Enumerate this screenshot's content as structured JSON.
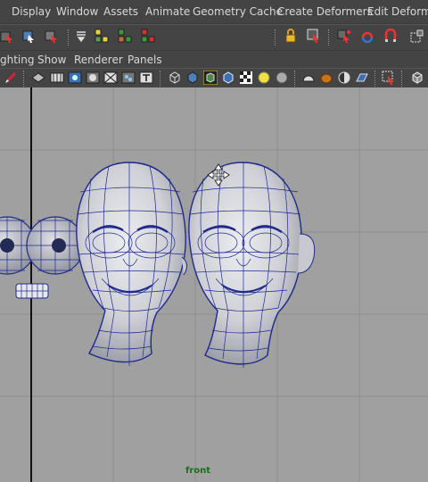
{
  "menubar": {
    "items": [
      "Display",
      "Window",
      "Assets",
      "Animate",
      "Geometry Cache",
      "Create Deformers",
      "Edit Deformers"
    ]
  },
  "panel_menu": {
    "items": [
      "ghting",
      "Show",
      "Renderer",
      "Panels"
    ]
  },
  "viewport": {
    "camera_label": "front",
    "background_color": "#a0a0a0",
    "grid_color": "#8e8e8e",
    "axis_color": "#111111",
    "wire_color": "#1f2a8a"
  },
  "icons": {
    "toolbar": [
      "select-tool-icon",
      "lasso-tool-icon",
      "paint-select-icon",
      "menu-collapse-icon",
      "snap-grid-icon",
      "snap-curve-icon",
      "snap-point-icon",
      "lock-icon",
      "transform-icon",
      "history-icon",
      "magnet-icon",
      "render-icon",
      "ipr-icon"
    ],
    "panel": [
      "pencil-icon",
      "camera-attr-icon",
      "bookmark-icon",
      "image-plane-icon",
      "grid-icon",
      "film-gate-icon",
      "resolution-gate-icon",
      "safe-action-icon",
      "text-icon",
      "wireframe-icon",
      "smooth-shade-icon",
      "wireframe-on-shaded-icon",
      "bounding-box-icon",
      "textured-icon",
      "light-icon",
      "shadow-icon",
      "isolate-icon",
      "xray-icon",
      "default-material-icon",
      "backface-icon",
      "xray-joints-icon",
      "select-camera-icon",
      "cube-icon"
    ]
  }
}
